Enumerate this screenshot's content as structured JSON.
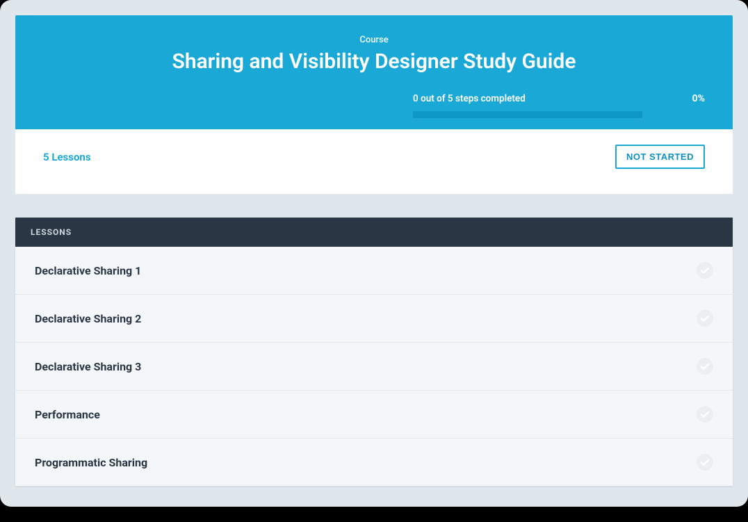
{
  "header": {
    "eyebrow": "Course",
    "title": "Sharing and Visibility Designer Study Guide",
    "progress_text": "0 out of 5 steps completed",
    "progress_pct_text": "0%",
    "progress_pct": 0
  },
  "meta": {
    "lessons_count_text": "5 Lessons",
    "status_label": "NOT STARTED"
  },
  "lessons": {
    "header": "LESSONS",
    "items": [
      {
        "title": "Declarative Sharing 1",
        "completed": false
      },
      {
        "title": "Declarative Sharing 2",
        "completed": false
      },
      {
        "title": "Declarative Sharing 3",
        "completed": false
      },
      {
        "title": "Performance",
        "completed": false
      },
      {
        "title": "Programmatic Sharing",
        "completed": false
      }
    ]
  }
}
